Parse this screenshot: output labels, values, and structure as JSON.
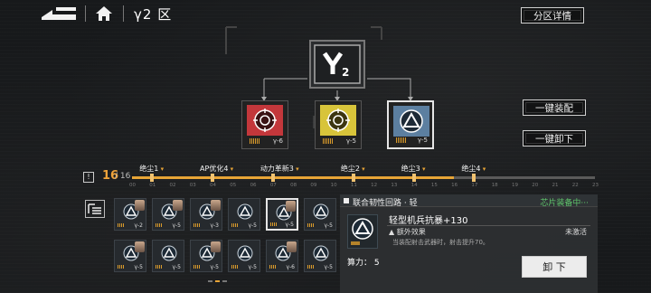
{
  "header": {
    "title": "γ2 区",
    "zone_detail_label": "分区详情"
  },
  "tree": {
    "root_icon": "gamma-2-emblem-icon",
    "chips": [
      {
        "label": "γ-6",
        "color": "#c3373b",
        "icon": "crosshair-chip-icon"
      },
      {
        "label": "γ-5",
        "color": "#d8c43a",
        "icon": "crosshair-chip-icon"
      },
      {
        "label": "γ-5",
        "color": "#5c7fa0",
        "icon": "triangle-chip-icon"
      }
    ]
  },
  "actions": {
    "auto_equip_label": "一键装配",
    "unequip_all_label": "一键卸下"
  },
  "progress": {
    "current": "16",
    "total": "/ 16",
    "milestones": [
      {
        "label": "绝尘1",
        "index": 1
      },
      {
        "label": "AP优化4",
        "index": 4
      },
      {
        "label": "动力革新3",
        "index": 7
      },
      {
        "label": "绝尘2",
        "index": 11
      },
      {
        "label": "绝尘3",
        "index": 14
      },
      {
        "label": "绝尘4",
        "index": 17
      }
    ],
    "ticks": [
      "00",
      "01",
      "02",
      "03",
      "04",
      "05",
      "06",
      "07",
      "08",
      "09",
      "10",
      "11",
      "12",
      "13",
      "14",
      "15",
      "16",
      "17",
      "18",
      "19",
      "20",
      "21",
      "22",
      "23"
    ],
    "filled": 16,
    "max": 23
  },
  "grid": {
    "items": [
      {
        "label": "γ-2",
        "portrait": true
      },
      {
        "label": "γ-5",
        "portrait": true
      },
      {
        "label": "γ-3",
        "portrait": true
      },
      {
        "label": "γ-5",
        "portrait": false
      },
      {
        "label": "γ-5",
        "portrait": true
      },
      {
        "label": "γ-5",
        "portrait": false
      },
      {
        "label": "γ-5",
        "portrait": true
      },
      {
        "label": "γ-5",
        "portrait": false
      },
      {
        "label": "γ-5",
        "portrait": true
      },
      {
        "label": "γ-5",
        "portrait": false
      },
      {
        "label": "γ-6",
        "portrait": true
      },
      {
        "label": "γ-5",
        "portrait": false
      }
    ],
    "page": 2,
    "pages": 3
  },
  "detail": {
    "title": "联合韧性回路 · 轻",
    "status": "芯片装备中···",
    "item_name": "轻型机兵抗暴+130",
    "effect_label": "额外效果",
    "effect_state": "未激活",
    "effect_desc": "当装配射击武器时，射击提升70。",
    "power": "算力： 5",
    "unequip_label": "卸 下"
  }
}
